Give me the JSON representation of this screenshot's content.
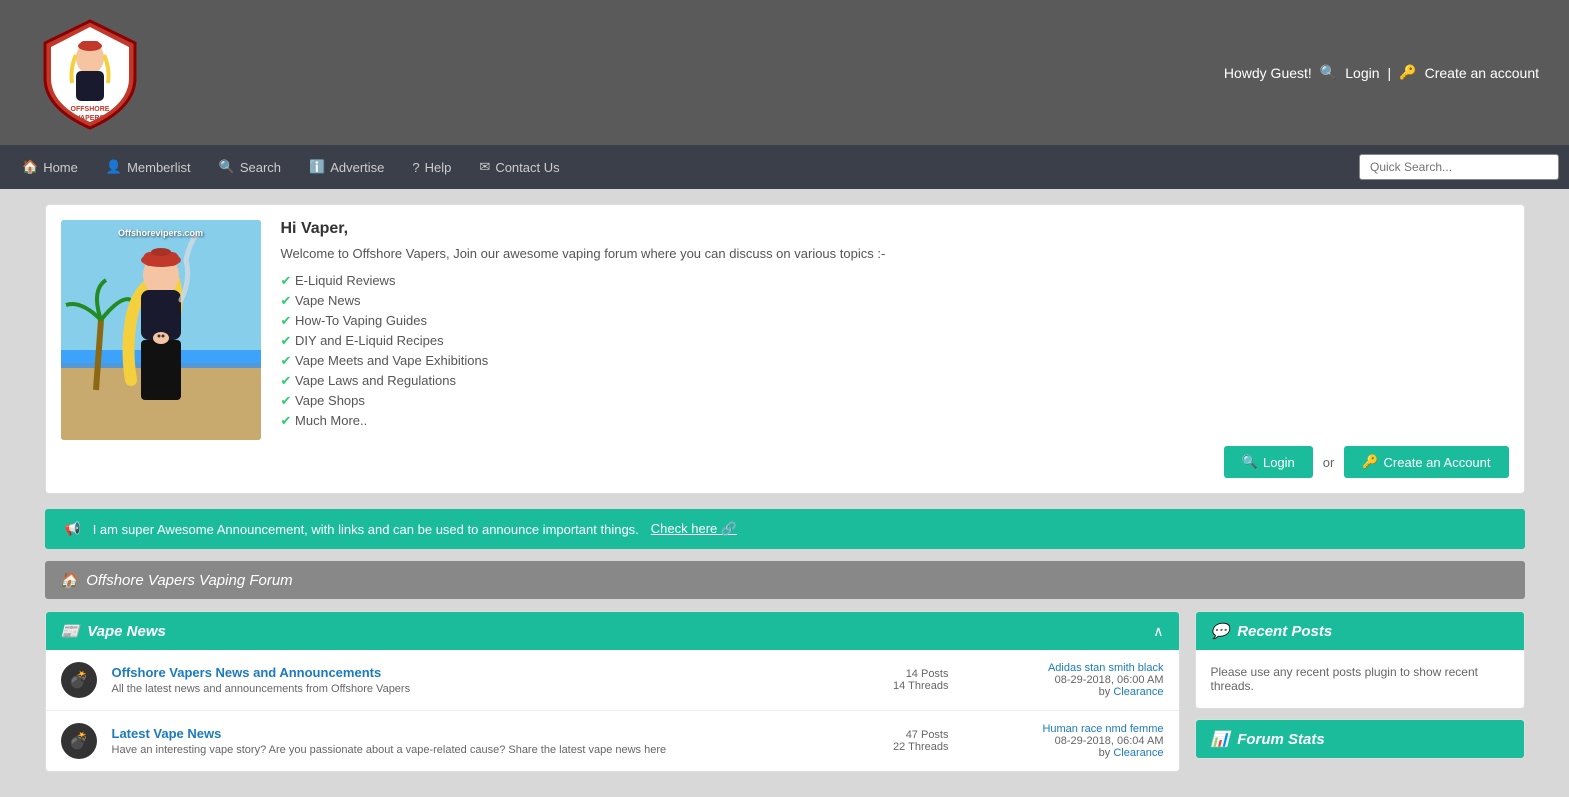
{
  "site": {
    "name": "Offshore Vapers",
    "tagline": "Offshorevipers.com"
  },
  "header": {
    "greeting": "Howdy Guest!",
    "login_label": "Login",
    "create_account_label": "Create an account",
    "separator": "|"
  },
  "navbar": {
    "items": [
      {
        "label": "Home",
        "icon": "🏠"
      },
      {
        "label": "Memberlist",
        "icon": "👤"
      },
      {
        "label": "Search",
        "icon": "🔍"
      },
      {
        "label": "Advertise",
        "icon": "ℹ️"
      },
      {
        "label": "Help",
        "icon": "?"
      },
      {
        "label": "Contact Us",
        "icon": "✉"
      }
    ],
    "search_placeholder": "Quick Search..."
  },
  "welcome": {
    "title": "Hi Vaper,",
    "intro": "Welcome to Offshore Vapers, Join our awesome vaping forum where you can discuss on various topics :-",
    "features": [
      "E-Liquid Reviews",
      "Vape News",
      "How-To Vaping Guides",
      "DIY and E-Liquid Recipes",
      "Vape Meets and Vape Exhibitions",
      "Vape Laws and Regulations",
      "Vape Shops",
      "Much More.."
    ],
    "login_btn": "Login",
    "or_text": "or",
    "create_btn": "Create an Account"
  },
  "announcement": {
    "text": "I am super Awesome Announcement, with links and can be used to announce important things.",
    "link_text": "Check here",
    "link_icon": "🔗"
  },
  "forum_title": "Offshore Vapers Vaping Forum",
  "sections": [
    {
      "id": "vape-news",
      "title": "Vape News",
      "icon": "📰",
      "forums": [
        {
          "name": "Offshore Vapers News and Announcements",
          "desc": "All the latest news and announcements from Offshore Vapers",
          "posts": "14 Posts",
          "threads": "14 Threads",
          "last_post_title": "Adidas stan smith black",
          "last_post_date": "08-29-2018, 06:00 AM",
          "last_post_by": "by",
          "last_post_author": "Clearance"
        },
        {
          "name": "Latest Vape News",
          "desc": "Have an interesting vape story? Are you passionate about a vape-related cause? Share the latest vape news here",
          "posts": "47 Posts",
          "threads": "22 Threads",
          "last_post_title": "Human race nmd femme",
          "last_post_date": "08-29-2018, 06:04 AM",
          "last_post_by": "by",
          "last_post_author": "Clearance"
        }
      ]
    }
  ],
  "sidebar": {
    "recent_posts": {
      "title": "Recent Posts",
      "icon": "💬",
      "text": "Please use any recent posts plugin to show recent threads."
    },
    "forum_stats": {
      "title": "Forum Stats",
      "icon": "📊"
    }
  }
}
